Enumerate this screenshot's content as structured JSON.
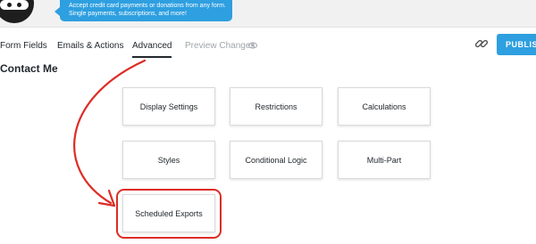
{
  "promo": {
    "text": "Accept credit card payments or donations from any form. Single payments, subscriptions, and more!"
  },
  "tabs": [
    {
      "label": "Form Fields",
      "state": "normal"
    },
    {
      "label": "Emails & Actions",
      "state": "normal"
    },
    {
      "label": "Advanced",
      "state": "active"
    },
    {
      "label": "Preview Changes",
      "state": "disabled"
    }
  ],
  "icons": {
    "preview": "eye-icon",
    "link": "link-icon",
    "logo": "ninja-logo"
  },
  "publish": {
    "label": "PUBLIS"
  },
  "form": {
    "title": "Contact Me"
  },
  "cards": [
    {
      "label": "Display Settings"
    },
    {
      "label": "Restrictions"
    },
    {
      "label": "Calculations"
    },
    {
      "label": "Styles"
    },
    {
      "label": "Conditional Logic"
    },
    {
      "label": "Multi-Part"
    },
    {
      "label": "Scheduled Exports"
    }
  ],
  "colors": {
    "accent": "#2e9fe0",
    "annotation": "#dd2c25"
  }
}
